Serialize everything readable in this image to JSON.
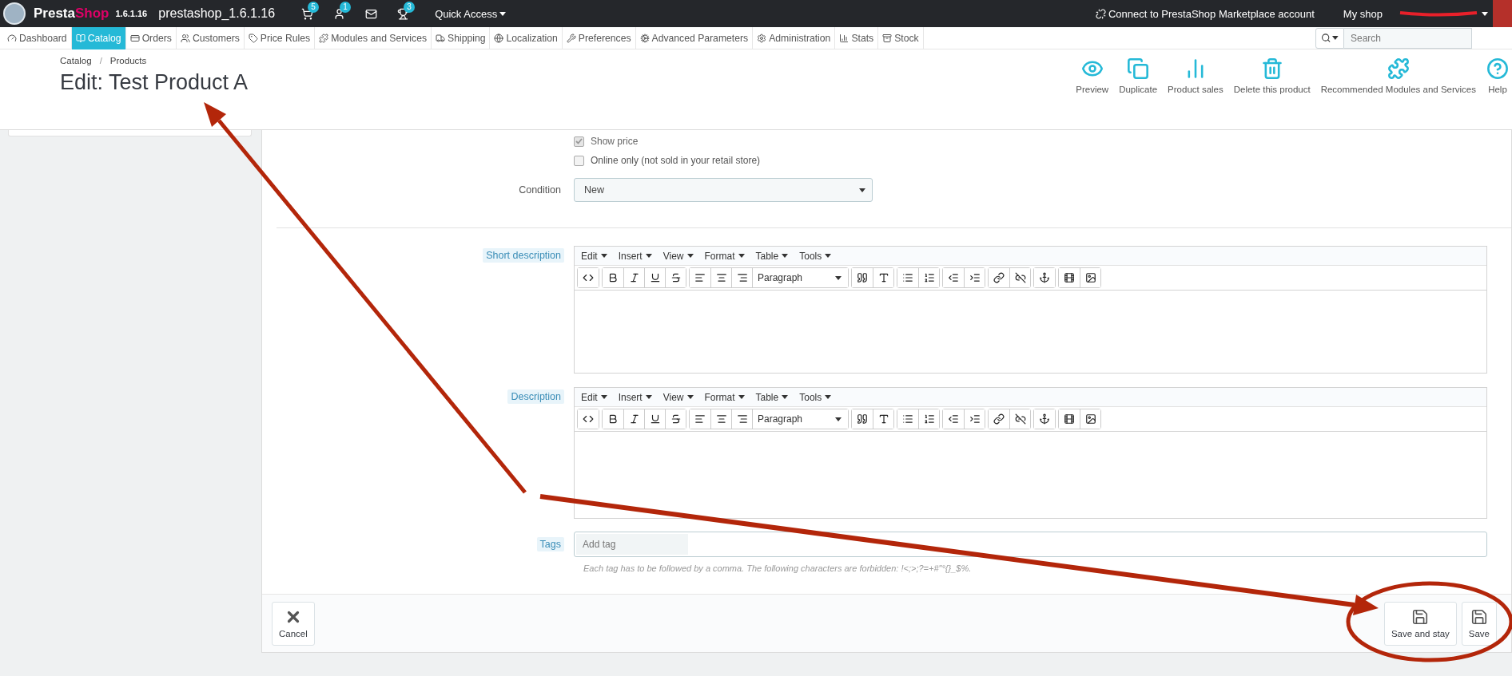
{
  "topbar": {
    "brand": [
      {
        "text": "Presta",
        "color": "#ffffff"
      },
      {
        "text": "Shop",
        "color": "#df0067"
      }
    ],
    "version": "1.6.1.16",
    "shop_name": "prestashop_1.6.1.16",
    "notifications": [
      {
        "kind": "cart",
        "count": "5"
      },
      {
        "kind": "customer",
        "count": "1"
      },
      {
        "kind": "message"
      },
      {
        "kind": "trophy",
        "count": "3"
      }
    ],
    "quick_access": "Quick Access",
    "connect": "Connect to PrestaShop Marketplace account",
    "my_shop": "My shop"
  },
  "nav": {
    "items": [
      {
        "label": "Dashboard",
        "kind": "dashboard",
        "selected": false
      },
      {
        "label": "Catalog",
        "kind": "catalog",
        "selected": true
      },
      {
        "label": "Orders",
        "kind": "orders",
        "selected": false
      },
      {
        "label": "Customers",
        "kind": "customers",
        "selected": false
      },
      {
        "label": "Price Rules",
        "kind": "rules",
        "selected": false
      },
      {
        "label": "Modules and Services",
        "kind": "modules",
        "selected": false
      },
      {
        "label": "Shipping",
        "kind": "shipping",
        "selected": false
      },
      {
        "label": "Localization",
        "kind": "localization",
        "selected": false
      },
      {
        "label": "Preferences",
        "kind": "preferences",
        "selected": false
      },
      {
        "label": "Advanced Parameters",
        "kind": "advanced",
        "selected": false
      },
      {
        "label": "Administration",
        "kind": "administration",
        "selected": false
      },
      {
        "label": "Stats",
        "kind": "stats",
        "selected": false
      },
      {
        "label": "Stock",
        "kind": "stock",
        "selected": false
      }
    ],
    "search": {
      "placeholder": "Search"
    }
  },
  "header": {
    "breadcrumb": [
      "Catalog",
      "Products"
    ],
    "breadcrumb_separator": "/",
    "title": "Edit: Test Product A",
    "actions": [
      {
        "label": "Preview",
        "kind": "preview"
      },
      {
        "label": "Duplicate",
        "kind": "duplicate"
      },
      {
        "label": "Product sales",
        "kind": "sales"
      },
      {
        "label": "Delete this product",
        "kind": "delete"
      },
      {
        "label": "Recommended Modules and Services",
        "kind": "modules"
      },
      {
        "label": "Help",
        "kind": "help"
      }
    ]
  },
  "form": {
    "checkboxes": [
      {
        "label": "Show price",
        "checked": true,
        "disabled": true
      },
      {
        "label": "Online only (not sold in your retail store)",
        "checked": false,
        "disabled": false
      }
    ],
    "condition": {
      "label": "Condition",
      "value": "New"
    },
    "editors": [
      {
        "label": "Short description",
        "menu": [
          "Edit",
          "Insert",
          "View",
          "Format",
          "Table",
          "Tools"
        ],
        "block_format": "Paragraph"
      },
      {
        "label": "Description",
        "menu": [
          "Edit",
          "Insert",
          "View",
          "Format",
          "Table",
          "Tools"
        ],
        "block_format": "Paragraph"
      }
    ],
    "tags": {
      "label": "Tags",
      "placeholder": "Add tag",
      "hint": "Each tag has to be followed by a comma. The following characters are forbidden: !<;>;?=+#\"°{}_$%."
    }
  },
  "footer": {
    "buttons": [
      {
        "label": "Cancel",
        "kind": "cancel"
      },
      {
        "label": "Save and stay",
        "kind": "save"
      },
      {
        "label": "Save",
        "kind": "save"
      }
    ]
  }
}
